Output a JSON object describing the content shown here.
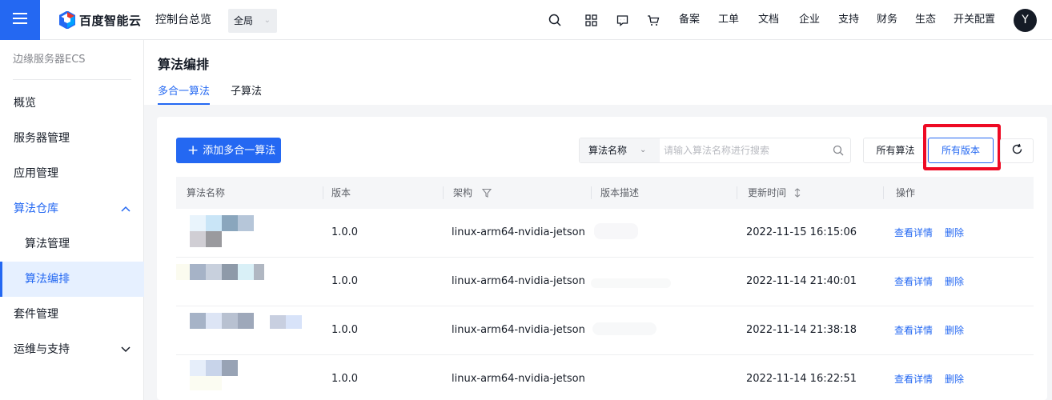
{
  "brand": {
    "name": "百度智能云",
    "color": "#2468f2"
  },
  "header": {
    "console_title": "控制台总览",
    "region": "全局",
    "icons": [
      "search-icon",
      "apps-grid-icon",
      "message-icon",
      "cart-icon"
    ],
    "links": [
      "备案",
      "工单",
      "文档",
      "企业",
      "支持",
      "财务",
      "生态",
      "开关配置"
    ],
    "avatar_letter": "Y"
  },
  "sidebar": {
    "title": "边缘服务器ECS",
    "items": [
      {
        "label": "概览"
      },
      {
        "label": "服务器管理"
      },
      {
        "label": "应用管理"
      },
      {
        "label": "算法仓库",
        "expanded": true
      },
      {
        "label": "算法管理"
      },
      {
        "label": "算法编排",
        "selected": true
      },
      {
        "label": "套件管理"
      },
      {
        "label": "运维与支持",
        "expanded": false
      }
    ]
  },
  "page": {
    "title": "算法编排",
    "tabs": [
      {
        "label": "多合一算法",
        "active": true
      },
      {
        "label": "子算法",
        "active": false
      }
    ]
  },
  "toolbar": {
    "add_label": "添加多合一算法",
    "search_type": "算法名称",
    "search_placeholder": "请输入算法名称进行搜索",
    "filter_all": "所有算法",
    "filter_versions": "所有版本",
    "highlight_color": "#ee0a24"
  },
  "table": {
    "columns": [
      "算法名称",
      "版本",
      "架构",
      "版本描述",
      "更新时间",
      "操作"
    ],
    "rows": [
      {
        "version": "1.0.0",
        "arch": "linux-arm64-nvidia-jetson",
        "updated": "2022-11-15 16:15:06",
        "action_detail": "查看详情",
        "action_delete": "删除"
      },
      {
        "version": "1.0.0",
        "arch": "linux-arm64-nvidia-jetson",
        "updated": "2022-11-14 21:40:01",
        "action_detail": "查看详情",
        "action_delete": "删除"
      },
      {
        "version": "1.0.0",
        "arch": "linux-arm64-nvidia-jetson",
        "updated": "2022-11-14 21:38:18",
        "action_detail": "查看详情",
        "action_delete": "删除"
      },
      {
        "version": "1.0.0",
        "arch": "linux-arm64-nvidia-jetson",
        "updated": "2022-11-14 16:22:51",
        "action_detail": "查看详情",
        "action_delete": "删除"
      }
    ]
  }
}
